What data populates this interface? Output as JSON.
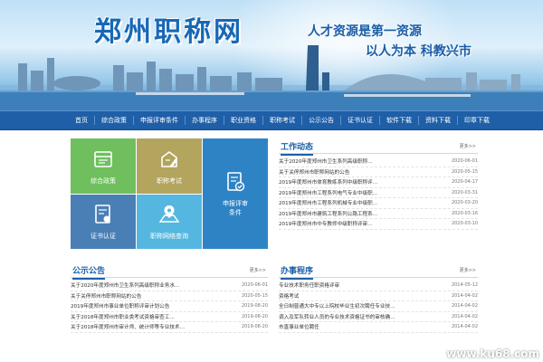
{
  "header": {
    "site_title": "郑州职称网",
    "slogan_1": "人才资源是第一资源",
    "slogan_2": "以人为本  科教兴市"
  },
  "nav": {
    "items": [
      "首页",
      "综合政策",
      "申报评审条件",
      "办事程序",
      "职业资格",
      "职称考试",
      "公示公告",
      "证书认证",
      "软件下载",
      "资料下载",
      "印章下载"
    ]
  },
  "tiles": [
    {
      "label": "综合政策",
      "icon": "folder-icon",
      "color": "#6fbf5e"
    },
    {
      "label": "职称考试",
      "icon": "exam-icon",
      "color": "#b3a45e"
    },
    {
      "label": "申报评审\n条件",
      "icon": "document-check-icon",
      "color": "#2e83c5"
    },
    {
      "label": "证书认证",
      "icon": "certificate-icon",
      "color": "#4a7fb6"
    },
    {
      "label": "职称网络查询",
      "icon": "map-pin-icon",
      "color": "#55b7e0"
    }
  ],
  "work_news": {
    "title": "工作动态",
    "more": "更多>>",
    "items": [
      {
        "text": "关于2020年度郑州市卫生系列高级职称…",
        "date": "2020-06-01"
      },
      {
        "text": "关于关停郑州市职称网站的公告",
        "date": "2020-05-15"
      },
      {
        "text": "2019年度郑州市体育教练系列中级职称评…",
        "date": "2020-04-17"
      },
      {
        "text": "2019年度郑州市工程系列电气专业中级职…",
        "date": "2020-03-31"
      },
      {
        "text": "2019年度郑州市工程系列机械专业中级职…",
        "date": "2020-03-20"
      },
      {
        "text": "2019年度郑州市建筑工程系列公路工程系…",
        "date": "2020-03-16"
      },
      {
        "text": "2019年度郑州市中专教师中级职称评审…",
        "date": "2020-03-10"
      }
    ]
  },
  "notice": {
    "title": "公示公告",
    "more": "更多>>",
    "items": [
      {
        "text": "关于2020年度郑州市卫生系列高级职称业务水…",
        "date": "2020-06-01"
      },
      {
        "text": "关于关停郑州市职称网站的公告",
        "date": "2020-05-15"
      },
      {
        "text": "2019年度郑州市事业单位职称评审计划公告",
        "date": "2019-08-20"
      },
      {
        "text": "关于2018年度郑州市职业类考试资格审查工…",
        "date": "2019-08-20"
      },
      {
        "text": "关于2018年度郑州市审计师、统计师等专业技术…",
        "date": "2019-08-20"
      }
    ]
  },
  "procedure": {
    "title": "办事程序",
    "more": "更多>>",
    "items": [
      {
        "text": "专业技术职务任职资格评审",
        "date": "2014-05-12"
      },
      {
        "text": "资格考试",
        "date": "2014-04-02"
      },
      {
        "text": "全日制普通大中专以上院校毕业生初次聘任专业技…",
        "date": "2014-04-02"
      },
      {
        "text": "调入及军队转业人员的专业技术资格证书的审核确…",
        "date": "2014-04-02"
      },
      {
        "text": "市直事业单位聘任",
        "date": "2014-04-02"
      }
    ]
  },
  "watermark": "www.ku68.com"
}
